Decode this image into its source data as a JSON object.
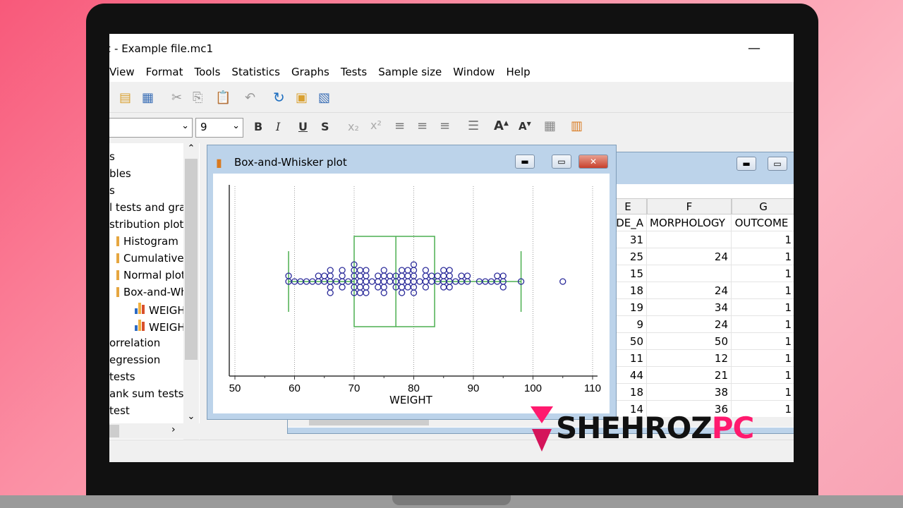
{
  "window": {
    "title": "c - Example file.mc1",
    "minimize": "—"
  },
  "menu": [
    "View",
    "Format",
    "Tools",
    "Statistics",
    "Graphs",
    "Tests",
    "Sample size",
    "Window",
    "Help"
  ],
  "toolbar": {
    "font_size": "9",
    "bold": "B",
    "italic": "I",
    "underline": "U",
    "strike": "S",
    "subscript": "x₂",
    "superscript": "x²"
  },
  "tree": [
    "s",
    "bles",
    "s",
    "l tests and grap",
    "stribution plot",
    "Histogram",
    "Cumulative fr",
    "Normal plot",
    "Box-and-Whi",
    "WEIGHT",
    "WEIGHT",
    "orrelation",
    "egression",
    "tests",
    "ank sum tests",
    "test"
  ],
  "graph_window": {
    "title": "Box-and-Whisker plot"
  },
  "chart_data": {
    "type": "box-and-whisker",
    "orientation": "horizontal",
    "xlabel": "WEIGHT",
    "xlim": [
      50,
      110
    ],
    "xticks": [
      50,
      60,
      70,
      80,
      90,
      100,
      110
    ],
    "grid": "vertical dotted",
    "box": {
      "whisker_low": 59,
      "q1": 70,
      "median": 77,
      "q3": 83.5,
      "whisker_high": 98
    },
    "outliers": [
      105
    ],
    "points": [
      59,
      59,
      60,
      61,
      62,
      63,
      64,
      64,
      65,
      65,
      66,
      66,
      66,
      66,
      66,
      67,
      68,
      68,
      68,
      68,
      69,
      70,
      70,
      70,
      70,
      70,
      70,
      71,
      71,
      71,
      71,
      71,
      72,
      72,
      72,
      72,
      72,
      73,
      74,
      74,
      74,
      75,
      75,
      75,
      75,
      75,
      76,
      76,
      77,
      77,
      77,
      78,
      78,
      78,
      78,
      78,
      79,
      79,
      79,
      79,
      80,
      80,
      80,
      80,
      80,
      80,
      81,
      82,
      82,
      82,
      82,
      83,
      83,
      84,
      84,
      85,
      85,
      85,
      85,
      86,
      86,
      86,
      86,
      87,
      88,
      88,
      89,
      89,
      91,
      92,
      93,
      94,
      94,
      95,
      95,
      95,
      98,
      105
    ],
    "colors": {
      "box": "#4caf50",
      "points": "#2b2b9a"
    }
  },
  "sheet": {
    "columns": [
      "E",
      "F",
      "G"
    ],
    "names": [
      "DE_A",
      "MORPHOLOGY",
      "OUTCOME"
    ],
    "rows": [
      [
        "31",
        "",
        "1"
      ],
      [
        "25",
        "24",
        "1"
      ],
      [
        "15",
        "",
        "1"
      ],
      [
        "18",
        "24",
        "1"
      ],
      [
        "19",
        "34",
        "1"
      ],
      [
        "9",
        "24",
        "1"
      ],
      [
        "50",
        "50",
        "1"
      ],
      [
        "11",
        "12",
        "1"
      ],
      [
        "44",
        "21",
        "1"
      ],
      [
        "18",
        "38",
        "1"
      ],
      [
        "14",
        "36",
        "1"
      ]
    ]
  },
  "watermark": {
    "text_a": "SHEHROZ",
    "text_b": "PC",
    "color_a": "#111111",
    "color_b": "#ff1a6e"
  }
}
